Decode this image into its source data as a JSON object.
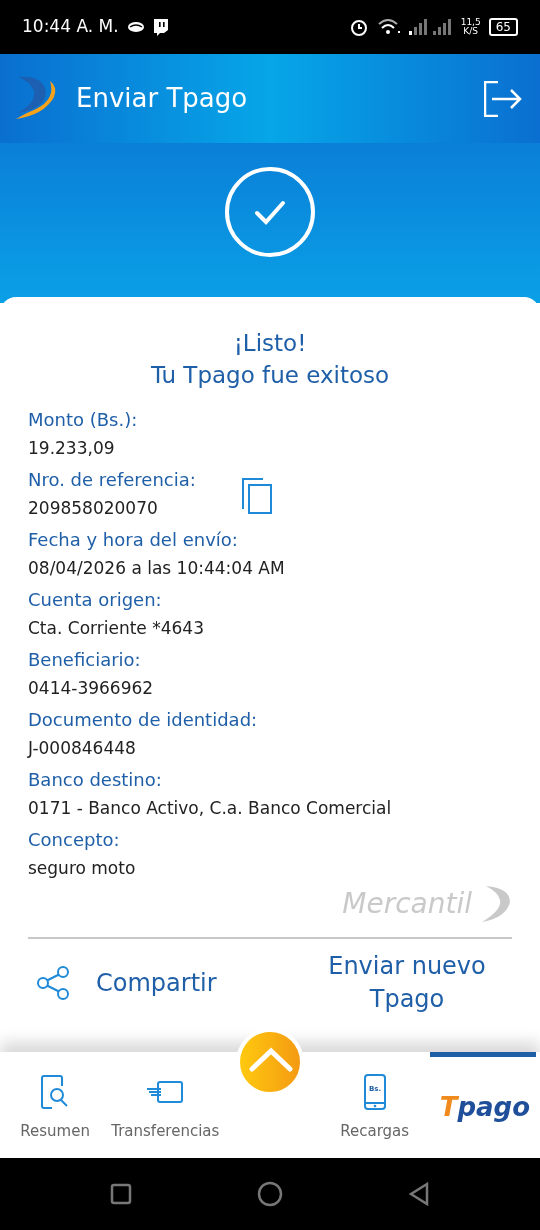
{
  "status_bar": {
    "time": "10:44 A. M.",
    "speed_value": "11,5",
    "speed_unit": "K/S",
    "battery": "65"
  },
  "header": {
    "title": "Enviar Tpago"
  },
  "result": {
    "title_line1": "¡Listo!",
    "title_line2": "Tu Tpago fue exitoso"
  },
  "fields": [
    {
      "label": "Monto (Bs.):",
      "value": "19.233,09",
      "copyable": false
    },
    {
      "label": "Nro. de referencia:",
      "value": "209858020070",
      "copyable": true
    },
    {
      "label": "Fecha y hora del envío:",
      "value": "08/04/2026 a las 10:44:04 AM",
      "copyable": false
    },
    {
      "label": "Cuenta origen:",
      "value": "Cta. Corriente *4643",
      "copyable": false
    },
    {
      "label": "Beneficiario:",
      "value": "0414-3966962",
      "copyable": false
    },
    {
      "label": "Documento de identidad:",
      "value": "J-000846448",
      "copyable": false
    },
    {
      "label": "Banco destino:",
      "value": "0171 - Banco Activo, C.a. Banco Comercial",
      "copyable": false
    },
    {
      "label": "Concepto:",
      "value": "seguro moto",
      "copyable": false
    }
  ],
  "brand": "Mercantil",
  "actions": {
    "share": "Compartir",
    "new_line1": "Enviar nuevo",
    "new_line2": "Tpago"
  },
  "bottom_nav": [
    {
      "kind": "resumen",
      "label": "Resumen",
      "selected": false
    },
    {
      "kind": "transfer",
      "label": "Transferencias",
      "selected": false
    },
    {
      "kind": "fab"
    },
    {
      "kind": "recargas",
      "label": "Recargas",
      "icon_text": "Bs.",
      "selected": false
    },
    {
      "kind": "logo",
      "label_parts": [
        "T",
        "pago"
      ],
      "selected": true
    }
  ]
}
